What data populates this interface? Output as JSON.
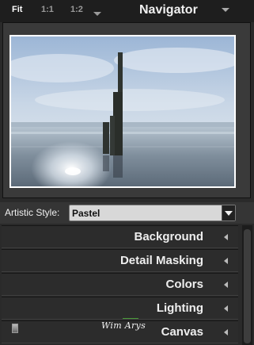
{
  "toolbar": {
    "zoom_fit": "Fit",
    "zoom_1_1": "1:1",
    "zoom_1_2": "1:2",
    "title": "Navigator"
  },
  "preview": {
    "subject": "seascape with wooden post on beach, pastel effect"
  },
  "style": {
    "label": "Artistic Style:",
    "selected": "Pastel"
  },
  "sections": [
    {
      "label": "Background"
    },
    {
      "label": "Detail Masking"
    },
    {
      "label": "Colors"
    },
    {
      "label": "Lighting"
    },
    {
      "label": "Canvas"
    }
  ],
  "signature": "Wim Arys",
  "colors": {
    "panel_bg": "#2a2a2a",
    "header_bg": "#1e1e1e",
    "select_bg": "#d8d8d8"
  }
}
